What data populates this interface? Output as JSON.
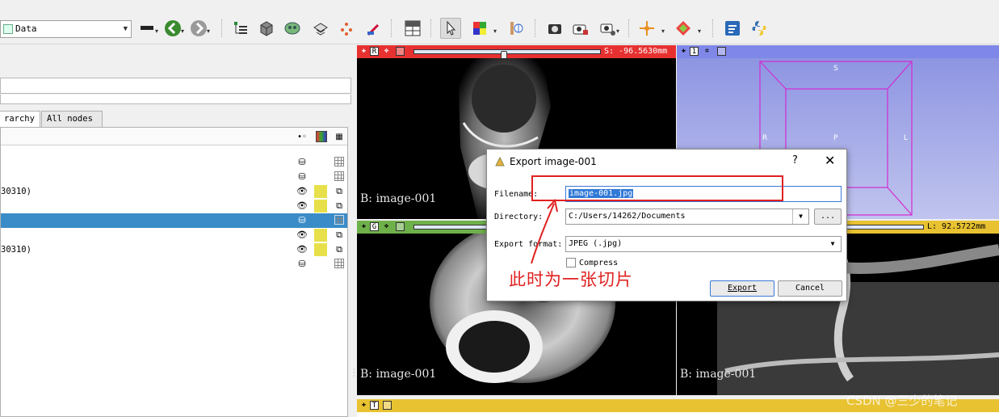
{
  "toolbar": {
    "module_selector": "Data",
    "buttons": [
      "data-icon",
      "dcm-icon",
      "save-icon",
      "back-arrow-icon",
      "forward-arrow-icon",
      "welcome-icon",
      "data-module-icon",
      "volumes-icon",
      "models-icon",
      "transforms-icon",
      "markups-icon",
      "segment-editor-icon",
      "layout-icon",
      "mouse-mode-icon",
      "window-level-icon",
      "crosshair-icon",
      "screenshot-icon",
      "scene-views-icon",
      "python-icon"
    ]
  },
  "left_panel": {
    "tabs": [
      "rarchy",
      "All nodes"
    ],
    "tree_rows": [
      {
        "label": "",
        "selected": false
      },
      {
        "label": "",
        "selected": false
      },
      {
        "label": "30310)",
        "selected": false
      },
      {
        "label": "",
        "selected": false
      },
      {
        "label": "",
        "selected": true
      },
      {
        "label": "",
        "selected": false
      },
      {
        "label": "30310)",
        "selected": false
      },
      {
        "label": "",
        "selected": false
      }
    ]
  },
  "views": {
    "red": {
      "letter": "R",
      "offset": "S: -96.5630mm",
      "slider_fraction": 0.48,
      "image_label": "B: image-001"
    },
    "three_d": {
      "letter": "1",
      "orient": {
        "top": "S",
        "left": "R",
        "center": "P",
        "right": "L"
      }
    },
    "green": {
      "letter": "G",
      "image_label": "B: image-001"
    },
    "yellow_view": {
      "offset": "L: 92.5722mm",
      "image_label": "B: image-001"
    },
    "bottom": {
      "letter": "T"
    }
  },
  "dialog": {
    "title": "Export image-001",
    "help": "?",
    "close": "✕",
    "filename_label": "Filename:",
    "filename_value": "image-001.jpg",
    "directory_label": "Directory:",
    "directory_value": "C:/Users/14262/Documents",
    "browse_label": "...",
    "format_label": "Export format:",
    "format_value": "JPEG (.jpg)",
    "compress_label": "Compress",
    "export_label": "Export",
    "cancel_label": "Cancel"
  },
  "annotation": {
    "text": "此时为一张切片",
    "color": "#e02020"
  },
  "watermark": "CSDN @三少的笔记"
}
